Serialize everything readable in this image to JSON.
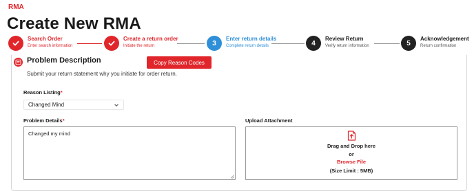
{
  "breadcrumb": "RMA",
  "page_title": "Create New RMA",
  "steps": [
    {
      "title": "Search Order",
      "subtitle": "Enter search information",
      "state": "done",
      "number": ""
    },
    {
      "title": "Create a return order",
      "subtitle": "Initiate the return",
      "state": "done",
      "number": ""
    },
    {
      "title": "Enter return details",
      "subtitle": "Complete return details",
      "state": "current",
      "number": "3"
    },
    {
      "title": "Review Return",
      "subtitle": "Verify return information",
      "state": "todo",
      "number": "4"
    },
    {
      "title": "Acknowledgement",
      "subtitle": "Return confirmation",
      "state": "todo",
      "number": "5"
    }
  ],
  "section": {
    "title": "Problem Description",
    "subtitle": "Submit your return statement why you initiate for order return.",
    "copy_button": "Copy Reason Codes"
  },
  "reason": {
    "label": "Reason Listing",
    "required_mark": "*",
    "selected": "Changed Mind"
  },
  "problem": {
    "label": "Problem Details",
    "required_mark": "*",
    "value": "Changed my mind"
  },
  "upload": {
    "label": "Upload Attachment",
    "drag_text": "Drag and Drop here",
    "or_text": "or",
    "browse_text": "Browse File",
    "limit_text": "(Size Limit : 5MB)"
  },
  "colors": {
    "accent": "#e0262b",
    "current": "#2f8fd8",
    "todo": "#222222"
  },
  "icons": {
    "done_step": "check-icon",
    "section": "list-icon",
    "dropdown": "chevron-down-icon",
    "upload": "file-upload-icon"
  }
}
